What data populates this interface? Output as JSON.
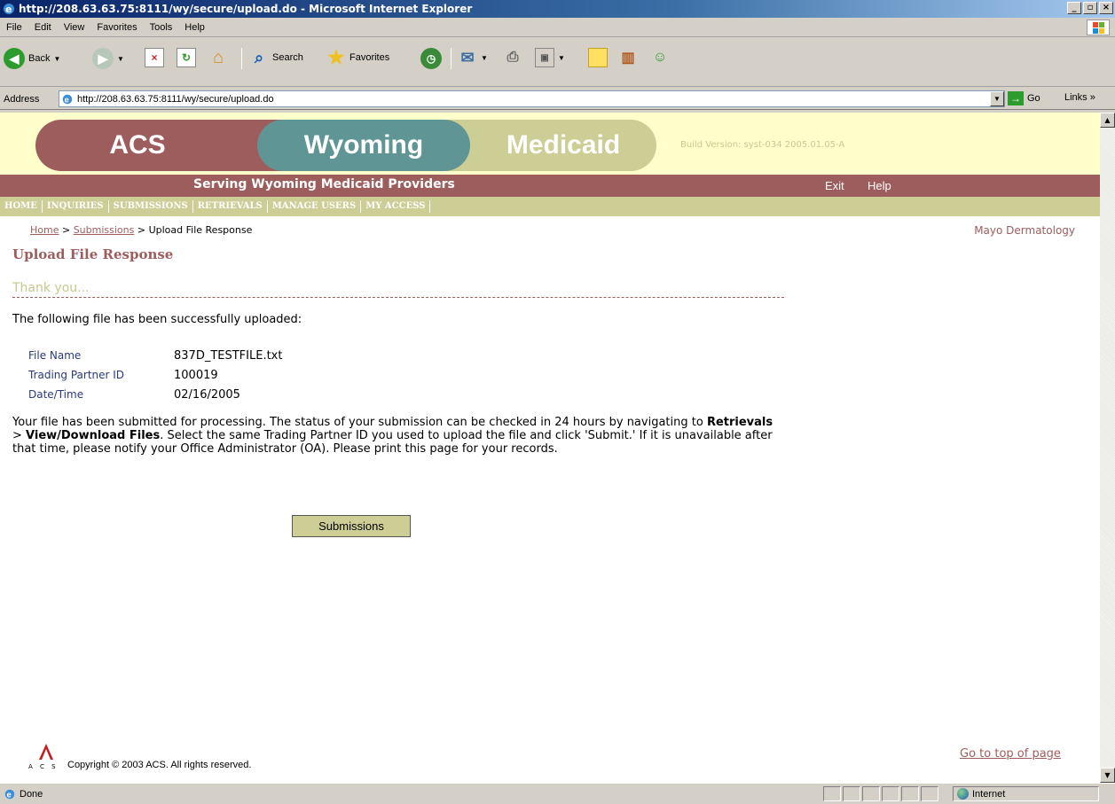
{
  "window": {
    "title": "http://208.63.63.75:8111/wy/secure/upload.do - Microsoft Internet Explorer",
    "controls": {
      "minimize": "_",
      "maximize": "▫",
      "close": "×"
    }
  },
  "menubar": {
    "items": [
      "File",
      "Edit",
      "View",
      "Favorites",
      "Tools",
      "Help"
    ]
  },
  "toolbar": {
    "back_label": "Back",
    "search_label": "Search",
    "favorites_label": "Favorites"
  },
  "address": {
    "label": "Address",
    "url": "http://208.63.63.75:8111/wy/secure/upload.do",
    "go_label": "Go",
    "links_label": "Links"
  },
  "banner": {
    "acs": "ACS",
    "wyoming": "Wyoming",
    "medicaid": "Medicaid",
    "build_version": "Build Version: syst-034 2005.01.05-A",
    "serving": "Serving Wyoming Medicaid Providers",
    "exit": "Exit",
    "help": "Help"
  },
  "nav": {
    "items": [
      "HOME",
      "INQUIRIES",
      "SUBMISSIONS",
      "RETRIEVALS",
      "MANAGE USERS",
      "MY ACCESS"
    ]
  },
  "breadcrumb": {
    "home": "Home",
    "submissions": "Submissions",
    "current": "Upload File Response",
    "separator": ">"
  },
  "organization": "Mayo Dermatology",
  "page": {
    "title": "Upload File Response",
    "thanks": "Thank you...",
    "success_message": "The following file has been successfully uploaded:",
    "details": [
      {
        "label": "File Name",
        "value": "837D_TESTFILE.txt"
      },
      {
        "label": "Trading Partner ID",
        "value": "100019"
      },
      {
        "label": "Date/Time",
        "value": "02/16/2005"
      }
    ],
    "paragraph": {
      "part1": "Your file has been submitted for processing. The status of your submission can be checked in 24 hours by navigating to ",
      "retrievals": "Retrievals",
      "sep": " > ",
      "view_download": "View/Download Files",
      "part2": ". Select the same Trading Partner ID you used to upload the file and click 'Submit.' If it is unavailable after that time, please notify your Office Administrator (OA). Please print this page for your records."
    },
    "submit_button": "Submissions"
  },
  "footer": {
    "copyright": "Copyright © 2003 ACS. All rights reserved.",
    "top_link": "Go to top of page",
    "logo_letters": "A C S"
  },
  "statusbar": {
    "status": "Done",
    "zone": "Internet"
  },
  "colors": {
    "brand_red": "#9e5d5d",
    "brand_teal": "#5f9595",
    "brand_khaki": "#cdcd96",
    "banner_bg": "#ffffcc"
  }
}
